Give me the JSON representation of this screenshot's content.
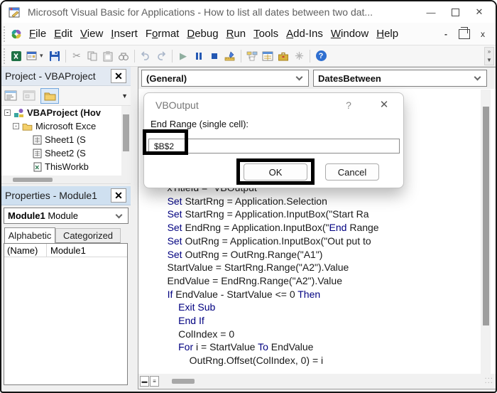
{
  "window": {
    "title": "Microsoft Visual Basic for Applications - How to list all dates between two dat...",
    "controls": {
      "minimize": "—",
      "close": "✕"
    }
  },
  "menu": {
    "items": [
      {
        "label": "File",
        "u": 0
      },
      {
        "label": "Edit",
        "u": 0
      },
      {
        "label": "View",
        "u": 0
      },
      {
        "label": "Insert",
        "u": 0
      },
      {
        "label": "Format",
        "u": 1
      },
      {
        "label": "Debug",
        "u": 0
      },
      {
        "label": "Run",
        "u": 0
      },
      {
        "label": "Tools",
        "u": 0
      },
      {
        "label": "Add-Ins",
        "u": 0
      },
      {
        "label": "Window",
        "u": 0
      },
      {
        "label": "Help",
        "u": 0
      }
    ],
    "mdi_controls": {
      "minimize": "-",
      "close": "x"
    }
  },
  "toolbar": {
    "icons": [
      "excel-icon",
      "insert-userform-icon",
      "dropdown-arrow-icon",
      "save-icon",
      "cut-icon",
      "copy-icon",
      "paste-icon",
      "find-icon",
      "undo-icon",
      "redo-icon",
      "run-icon",
      "break-icon",
      "reset-icon",
      "design-mode-icon",
      "project-explorer-icon",
      "properties-window-icon",
      "toolbox-icon",
      "object-browser-icon",
      "help-icon"
    ],
    "cut_glyph": "✂",
    "run_glyph": "▶",
    "help_glyph": "?",
    "overflow_glyphs": {
      "more": "»",
      "down": "▼"
    }
  },
  "project_panel": {
    "title": "Project - VBAProject",
    "close": "✕",
    "toolbar_icons": [
      "view-code-icon",
      "view-object-icon",
      "toggle-folders-icon"
    ],
    "tree": [
      {
        "label": "VBAProject (Hov",
        "expand": "-",
        "icon": "vba-project-icon"
      },
      {
        "label": "Microsoft Exce",
        "expand": "-",
        "icon": "excel-objects-folder-icon"
      },
      {
        "label": "Sheet1 (S",
        "icon": "worksheet-icon"
      },
      {
        "label": "Sheet2 (S",
        "icon": "worksheet-icon"
      },
      {
        "label": "ThisWorkb",
        "icon": "workbook-icon"
      }
    ]
  },
  "properties_panel": {
    "title": "Properties - Module1",
    "close": "✕",
    "object_selector": {
      "name": "Module1",
      "type": " Module"
    },
    "tabs": [
      {
        "label": "Alphabetic"
      },
      {
        "label": "Categorized"
      }
    ],
    "rows": [
      {
        "property": "(Name)",
        "value": "Module1"
      }
    ]
  },
  "code_window": {
    "left_dropdown": "(General)",
    "right_dropdown": "DatesBetween",
    "keyword_color": "#000080",
    "keywords": [
      "Set",
      "If",
      "Then",
      "Exit",
      "Sub",
      "End",
      "For",
      "To"
    ],
    "lines": [
      "    xTitleId = \"VBOutput\"",
      "    Set StartRng = Application.Selection",
      "    Set StartRng = Application.InputBox(\"Start Ra",
      "    Set EndRng = Application.InputBox(\"End Range ",
      "    Set OutRng = Application.InputBox(\"Out put to",
      "    Set OutRng = OutRng.Range(\"A1\")",
      "    StartValue = StartRng.Range(\"A2\").Value",
      "    EndValue = EndRng.Range(\"A2\").Value",
      "    If EndValue - StartValue <= 0 Then",
      "        Exit Sub",
      "        End If",
      "        ColIndex = 0",
      "        For i = StartValue To EndValue",
      "            OutRng.Offset(ColIndex, 0) = i"
    ]
  },
  "dialog": {
    "title": "VBOutput",
    "help_button": "?",
    "close_button": "✕",
    "label": "End Range (single cell):",
    "input_value": "$B$2",
    "ok_label": "OK",
    "cancel_label": "Cancel",
    "annotation_color": "#000000"
  }
}
